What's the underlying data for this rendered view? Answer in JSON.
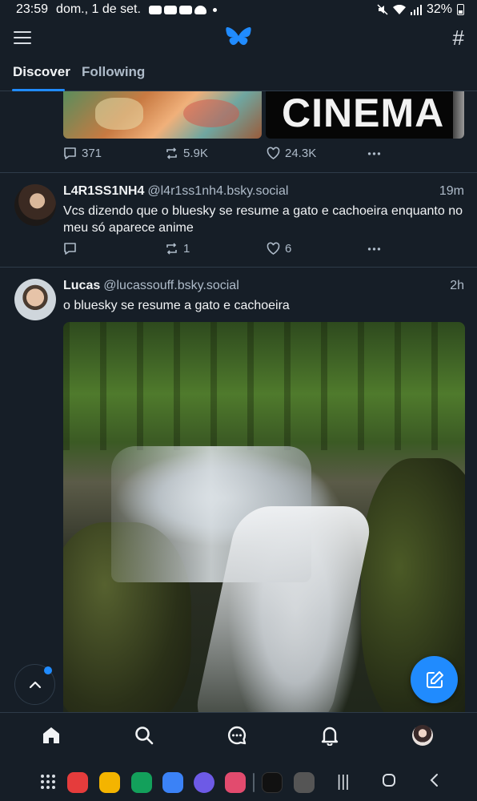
{
  "status_bar": {
    "time": "23:59",
    "date": "dom., 1 de set.",
    "battery": "32%"
  },
  "top_nav": {
    "menu_icon": "hamburger-icon",
    "logo_icon": "butterfly-logo-icon",
    "feeds_icon": "hash-icon"
  },
  "tabs": [
    {
      "label": "Discover",
      "active": true
    },
    {
      "label": "Following",
      "active": false
    }
  ],
  "colors": {
    "accent": "#208bfe",
    "background": "#161e27",
    "muted_text": "#aebbc9",
    "divider": "#2e3b49"
  },
  "feed": {
    "partial_post": {
      "image_b_text": "CINEMA",
      "replies": "371",
      "reposts": "5.9K",
      "likes": "24.3K"
    },
    "posts": [
      {
        "display_name": "L4R1SS1NH4",
        "handle": "@l4r1ss1nh4.bsky.social",
        "time": "19m",
        "text": "Vcs dizendo que o bluesky se resume a gato e cachoeira enquanto no meu só aparece anime",
        "replies": "",
        "reposts": "1",
        "likes": "6"
      },
      {
        "display_name": "Lucas",
        "handle": "@lucassouff.bsky.social",
        "time": "2h",
        "text": "o bluesky se resume a gato e cachoeira",
        "image": "waterfall-photo"
      }
    ]
  },
  "floating": {
    "scroll_top_icon": "chevron-up-icon",
    "compose_icon": "compose-icon"
  },
  "bottom_nav": [
    {
      "name": "home",
      "icon": "home-icon"
    },
    {
      "name": "search",
      "icon": "search-icon"
    },
    {
      "name": "chat",
      "icon": "chat-icon"
    },
    {
      "name": "notifications",
      "icon": "bell-icon"
    },
    {
      "name": "profile",
      "icon": "avatar"
    }
  ]
}
